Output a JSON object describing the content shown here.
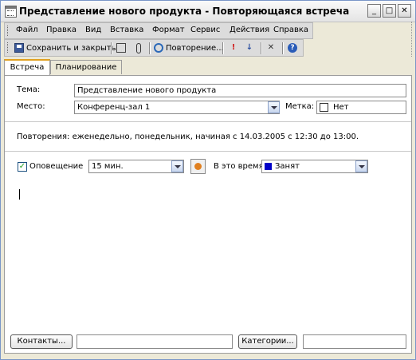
{
  "window": {
    "title": "Представление нового продукта - Повторяющаяся встреча",
    "controls": {
      "minimize": "_",
      "maximize": "□",
      "close": "✕"
    }
  },
  "menu": {
    "items": [
      "Файл",
      "Правка",
      "Вид",
      "Вставка",
      "Формат",
      "Сервис",
      "Действия",
      "Справка"
    ]
  },
  "toolbar": {
    "save_close_label": "Сохранить и закрыть",
    "recurrence_label": "Повторение..."
  },
  "tabs": [
    {
      "label": "Встреча",
      "active": true
    },
    {
      "label": "Планирование",
      "active": false
    }
  ],
  "form": {
    "subject_label": "Тема:",
    "subject_value": "Представление нового продукта",
    "location_label": "Место:",
    "location_value": "Конференц-зал 1",
    "mark_label": "Метка:",
    "mark_value": "Нет",
    "recurrence_text": "Повторения: еженедельно, понедельник, начиная с 14.03.2005 с 12:30 до 13:00.",
    "reminder_label": "Оповещение",
    "reminder_checked": true,
    "reminder_value": "15 мин.",
    "show_as_label": "В это время:",
    "show_as_value": "Занят",
    "busy_color": "#0000c8"
  },
  "bottom": {
    "contacts_label": "Контакты...",
    "categories_label": "Категории..."
  }
}
